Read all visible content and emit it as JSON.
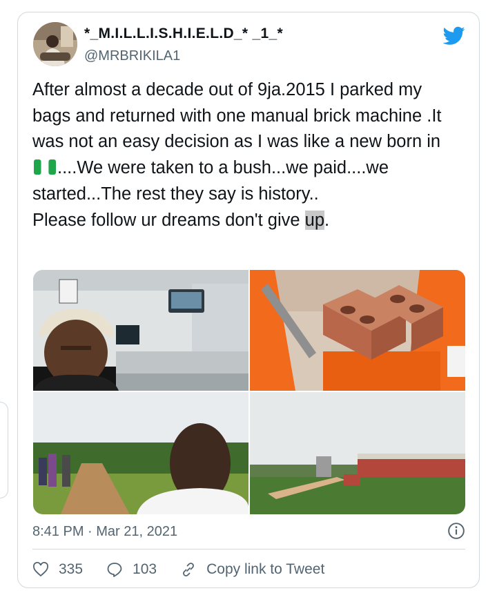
{
  "tweet": {
    "display_name": "*_M.I.L.L.I.S.H.I.E.L.D_* _1_*",
    "handle": "@MRBRIKILA1",
    "body_1": "After almost a decade out of 9ja.2015 I parked my bags and returned with one manual brick machine .It was not an easy decision as I was like a new born in",
    "body_2": "....We were taken to a bush...we paid....we started...The rest they say is history..",
    "body_3": "Please follow ur dreams don't give ",
    "body_highlight": "up",
    "body_end": ".",
    "flag_icon": "nigeria-flag-emoji",
    "timestamp": "8:41 PM · Mar 21, 2021"
  },
  "actions": {
    "likes": "335",
    "replies": "103",
    "copy_link": "Copy link to Tweet"
  },
  "media": [
    "airport-selfie-photo",
    "brick-machine-photo",
    "bush-selfie-photo",
    "building-site-photo"
  ],
  "colors": {
    "text": "#0f1419",
    "secondary": "#536471",
    "border": "#cfd9de",
    "twitter_blue": "#1d9bf0",
    "machine_orange": "#f26a1b",
    "brick": "#b8674a"
  }
}
